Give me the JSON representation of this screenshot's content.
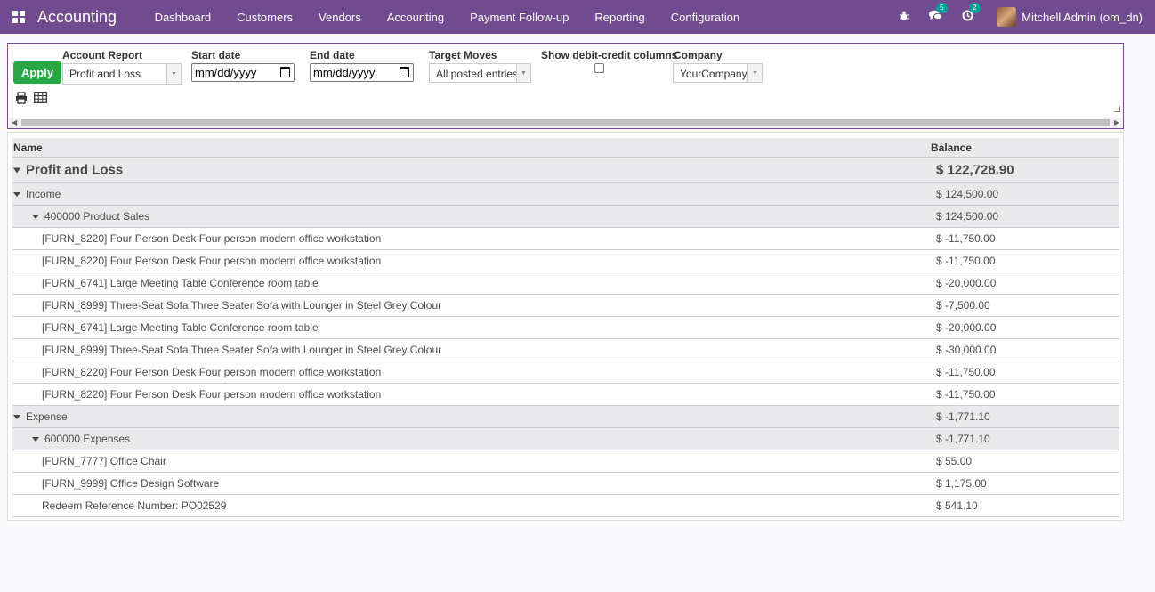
{
  "navbar": {
    "brand": "Accounting",
    "menu": [
      "Dashboard",
      "Customers",
      "Vendors",
      "Accounting",
      "Payment Follow-up",
      "Reporting",
      "Configuration"
    ],
    "messages_badge": "5",
    "activity_badge": "2",
    "user": "Mitchell Admin (om_dn)",
    "accent": "#714b8f"
  },
  "controls": {
    "apply_label": "Apply",
    "account_report_label": "Account Report",
    "account_report_value": "Profit and Loss",
    "start_date_label": "Start date",
    "start_date_value": "mm/dd/yyyy",
    "end_date_label": "End date",
    "end_date_value": "mm/dd/yyyy",
    "target_moves_label": "Target Moves",
    "target_moves_value": "All posted entries",
    "debit_credit_label": "Show debit-credit columns",
    "debit_credit_checked": false,
    "company_label": "Company",
    "company_value": "YourCompany"
  },
  "report": {
    "col_name": "Name",
    "col_balance": "Balance",
    "rows": [
      {
        "name": "Profit and Loss",
        "balance": "$ 122,728.90",
        "level": 0,
        "style": "big",
        "toggle": true
      },
      {
        "name": "Income",
        "balance": "$ 124,500.00",
        "level": 1,
        "style": "grey",
        "toggle": true
      },
      {
        "name": "400000 Product Sales",
        "balance": "$ 124,500.00",
        "level": 2,
        "style": "grey",
        "toggle": true
      },
      {
        "name": "[FURN_8220] Four Person Desk Four person modern office workstation",
        "balance": "$ -11,750.00",
        "level": 3,
        "style": "plain",
        "toggle": false
      },
      {
        "name": "[FURN_8220] Four Person Desk Four person modern office workstation",
        "balance": "$ -11,750.00",
        "level": 3,
        "style": "plain",
        "toggle": false
      },
      {
        "name": "[FURN_6741] Large Meeting Table Conference room table",
        "balance": "$ -20,000.00",
        "level": 3,
        "style": "plain",
        "toggle": false
      },
      {
        "name": "[FURN_8999] Three-Seat Sofa Three Seater Sofa with Lounger in Steel Grey Colour",
        "balance": "$ -7,500.00",
        "level": 3,
        "style": "plain",
        "toggle": false
      },
      {
        "name": "[FURN_6741] Large Meeting Table Conference room table",
        "balance": "$ -20,000.00",
        "level": 3,
        "style": "plain",
        "toggle": false
      },
      {
        "name": "[FURN_8999] Three-Seat Sofa Three Seater Sofa with Lounger in Steel Grey Colour",
        "balance": "$ -30,000.00",
        "level": 3,
        "style": "plain",
        "toggle": false
      },
      {
        "name": "[FURN_8220] Four Person Desk Four person modern office workstation",
        "balance": "$ -11,750.00",
        "level": 3,
        "style": "plain",
        "toggle": false
      },
      {
        "name": "[FURN_8220] Four Person Desk Four person modern office workstation",
        "balance": "$ -11,750.00",
        "level": 3,
        "style": "plain",
        "toggle": false
      },
      {
        "name": "Expense",
        "balance": "$ -1,771.10",
        "level": 1,
        "style": "grey",
        "toggle": true
      },
      {
        "name": "600000 Expenses",
        "balance": "$ -1,771.10",
        "level": 2,
        "style": "grey",
        "toggle": true
      },
      {
        "name": "[FURN_7777] Office Chair",
        "balance": "$ 55.00",
        "level": 3,
        "style": "plain",
        "toggle": false
      },
      {
        "name": "[FURN_9999] Office Design Software",
        "balance": "$ 1,175.00",
        "level": 3,
        "style": "plain",
        "toggle": false
      },
      {
        "name": "Redeem Reference Number: PO02529",
        "balance": "$ 541.10",
        "level": 3,
        "style": "plain",
        "toggle": false
      }
    ]
  }
}
